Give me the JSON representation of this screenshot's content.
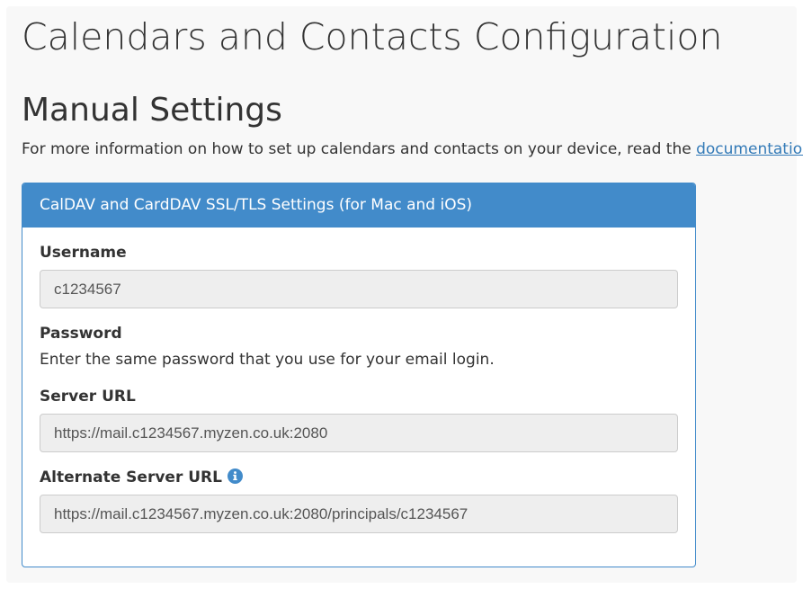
{
  "page": {
    "title": "Calendars and Contacts Configuration",
    "section_title": "Manual Settings",
    "intro_text": "For more information on how to set up calendars and contacts on your device, read the ",
    "intro_link": "documentation",
    "intro_suffix": "."
  },
  "panel": {
    "heading": "CalDAV and CardDAV SSL/TLS Settings (for Mac and iOS)",
    "username_label": "Username",
    "username_value": "c1234567",
    "password_label": "Password",
    "password_help": "Enter the same password that you use for your email login.",
    "server_url_label": "Server URL",
    "server_url_value": "https://mail.c1234567.myzen.co.uk:2080",
    "alt_server_url_label": "Alternate Server URL",
    "alt_server_url_icon": "info-icon",
    "alt_server_url_value": "https://mail.c1234567.myzen.co.uk:2080/principals/c1234567"
  },
  "colors": {
    "accent": "#428bca",
    "link": "#337ab7",
    "input_bg": "#eeeeee",
    "page_bg": "#f8f8f8"
  }
}
